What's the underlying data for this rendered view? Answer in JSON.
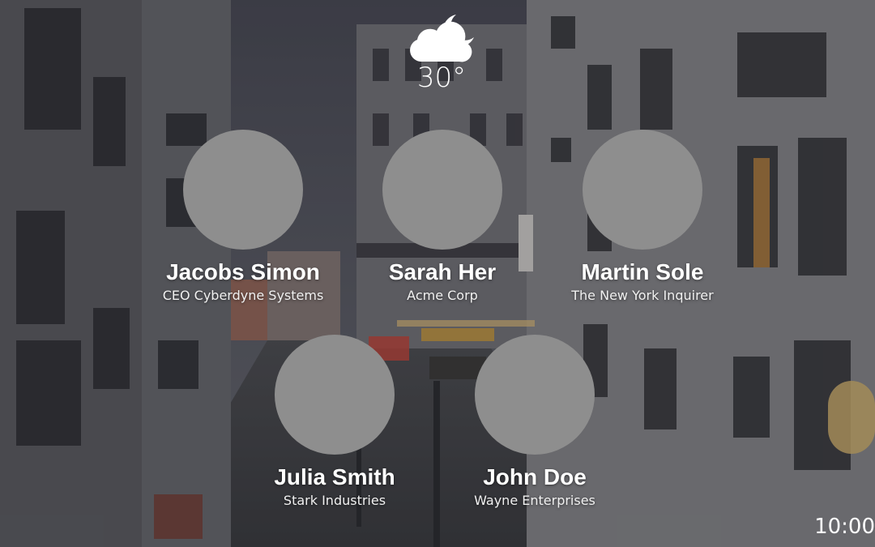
{
  "weather": {
    "icon": "cloud-moon-icon",
    "temperature": "30°"
  },
  "contacts": [
    {
      "name": "Jacobs Simon",
      "org": "CEO Cyberdyne Systems"
    },
    {
      "name": "Sarah Her",
      "org": "Acme Corp"
    },
    {
      "name": "Martin Sole",
      "org": "The New York Inquirer"
    },
    {
      "name": "Julia Smith",
      "org": "Stark Industries"
    },
    {
      "name": "John Doe",
      "org": "Wayne Enterprises"
    }
  ],
  "clock": {
    "time": "10:00"
  },
  "colors": {
    "avatar_placeholder": "#8e8e8e",
    "text": "#ffffff"
  }
}
